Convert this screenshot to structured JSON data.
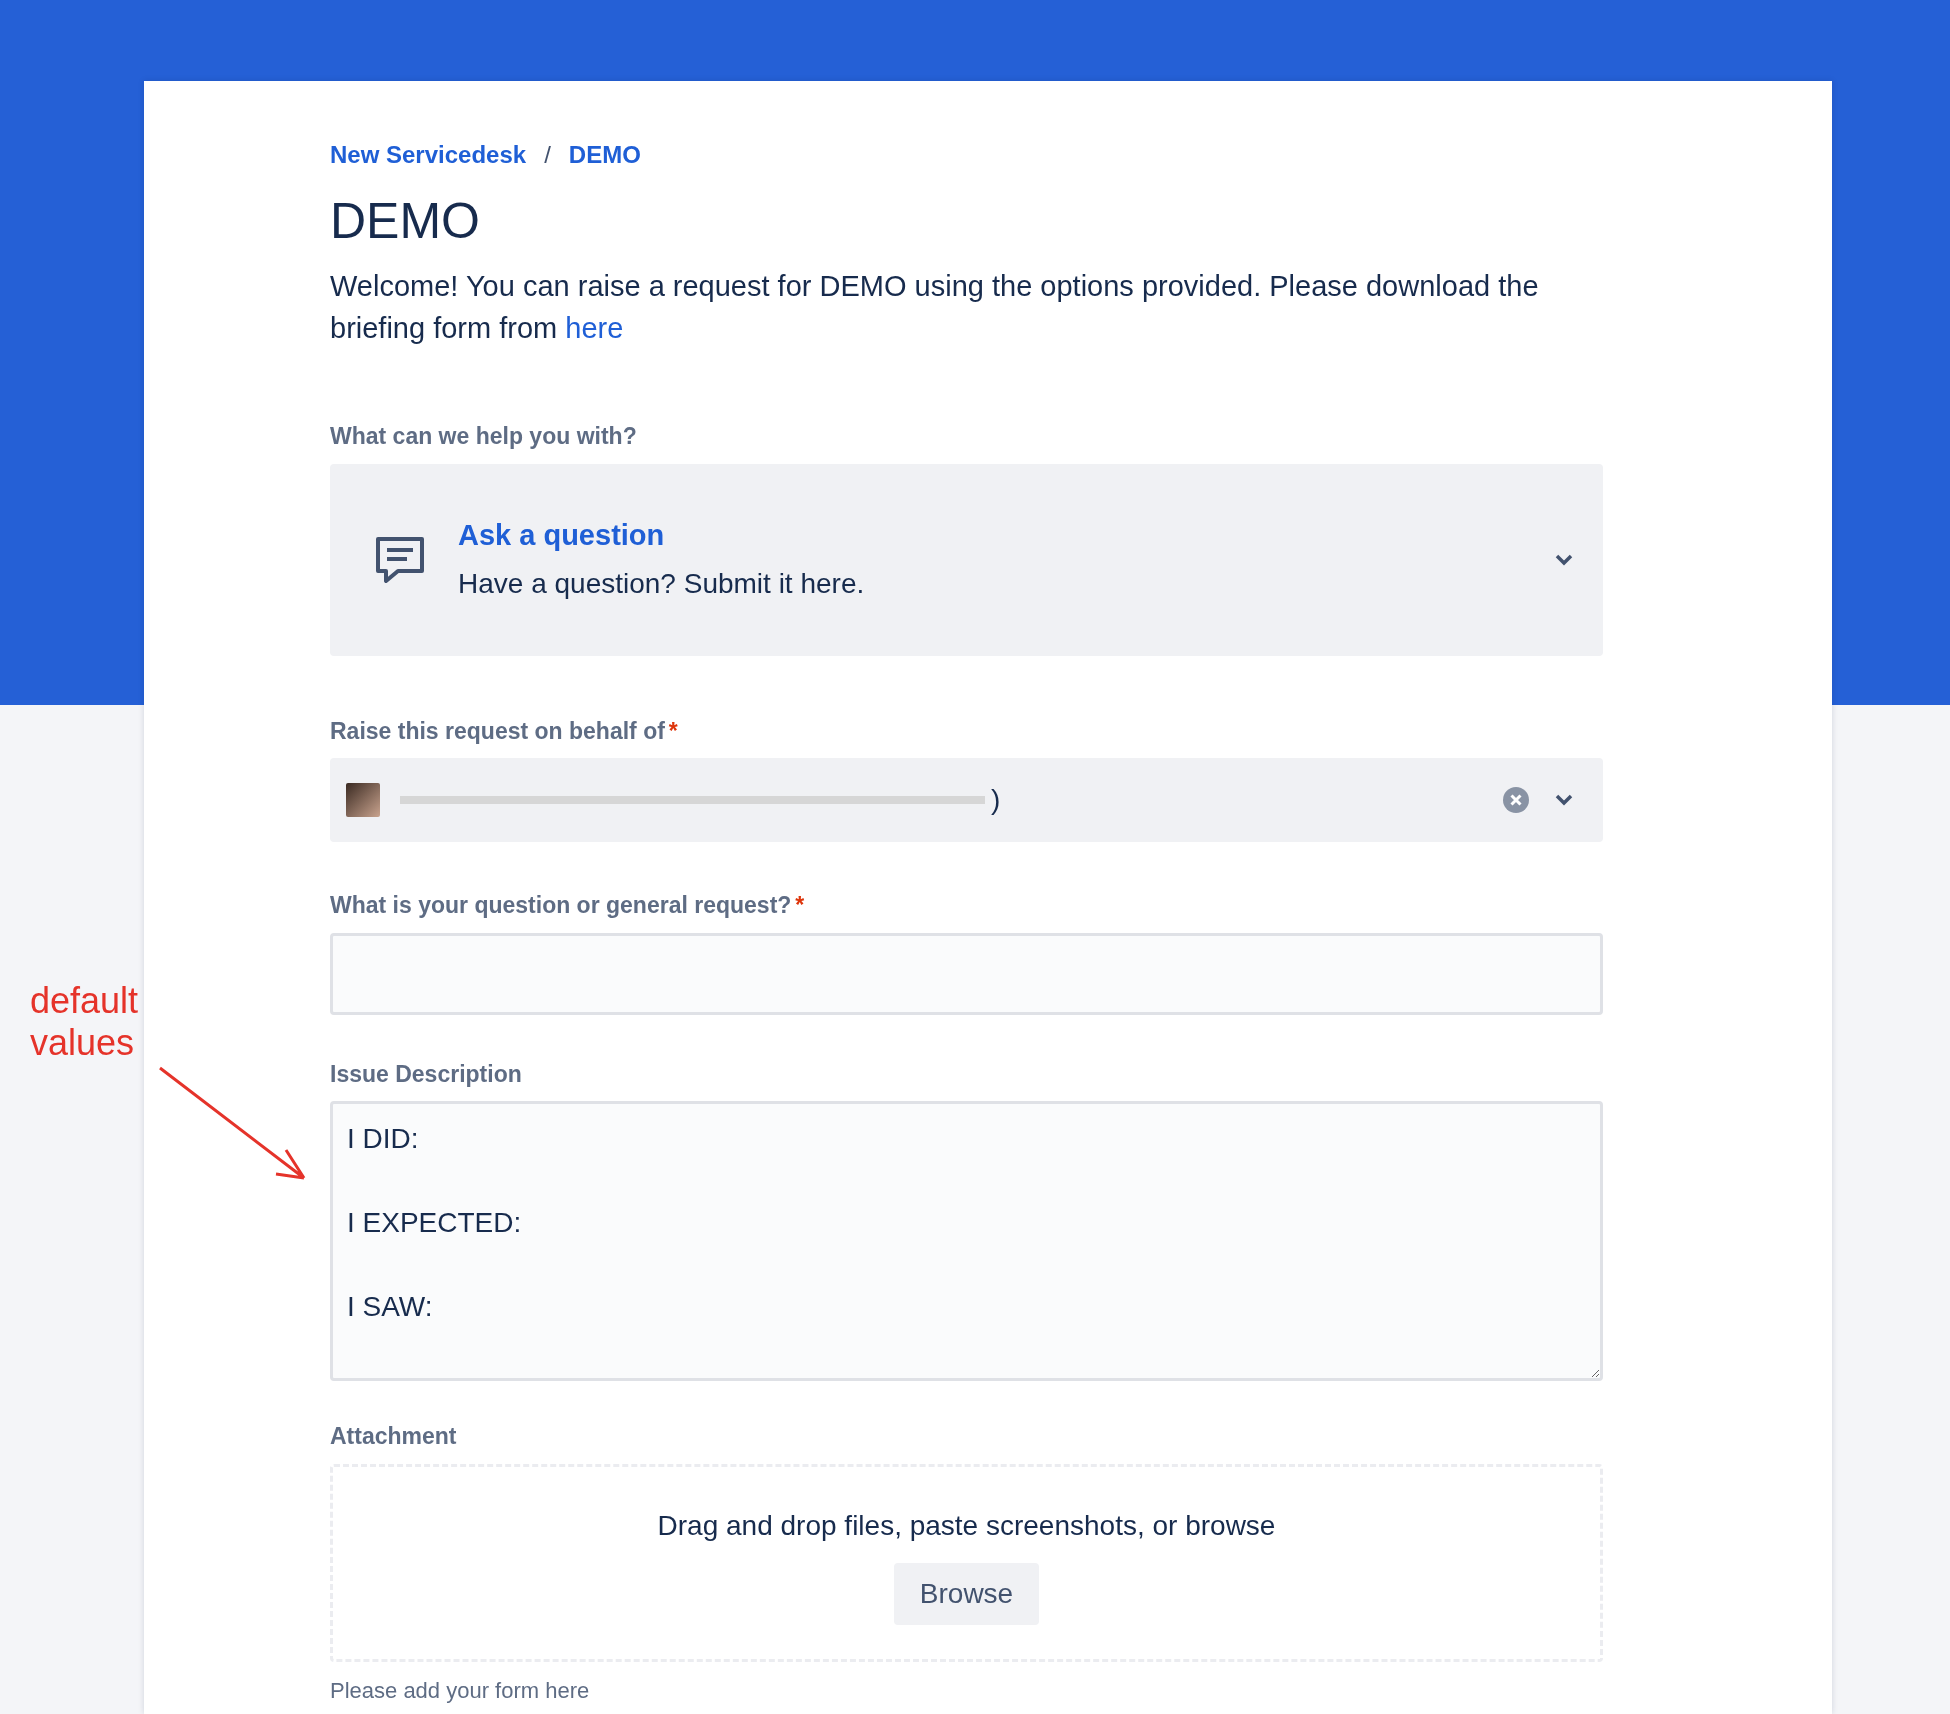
{
  "breadcrumb": [
    "New Servicedesk",
    "DEMO"
  ],
  "breadcrumb_separator": "/",
  "required_mark": "*",
  "title": "DEMO",
  "welcome": {
    "text": "Welcome! You can raise a request for DEMO using the options provided. Please download the briefing form from",
    "link": "here"
  },
  "request_type": {
    "label": "What can we help you with?",
    "name": "Ask a question",
    "description": "Have a question? Submit it here."
  },
  "on_behalf": {
    "label": "Raise this request on behalf of",
    "required": true,
    "value": ")"
  },
  "question": {
    "label": "What is your question or general request?",
    "required": true
  },
  "description": {
    "label": "Issue Description",
    "value": "I DID:\n\nI EXPECTED:\n\nI SAW:"
  },
  "attachment": {
    "label": "Attachment",
    "hint": "Drag and drop files, paste screenshots, or browse",
    "button": "Browse",
    "help": "Please add your form here"
  },
  "annotation": {
    "text": "default\nvalues"
  }
}
